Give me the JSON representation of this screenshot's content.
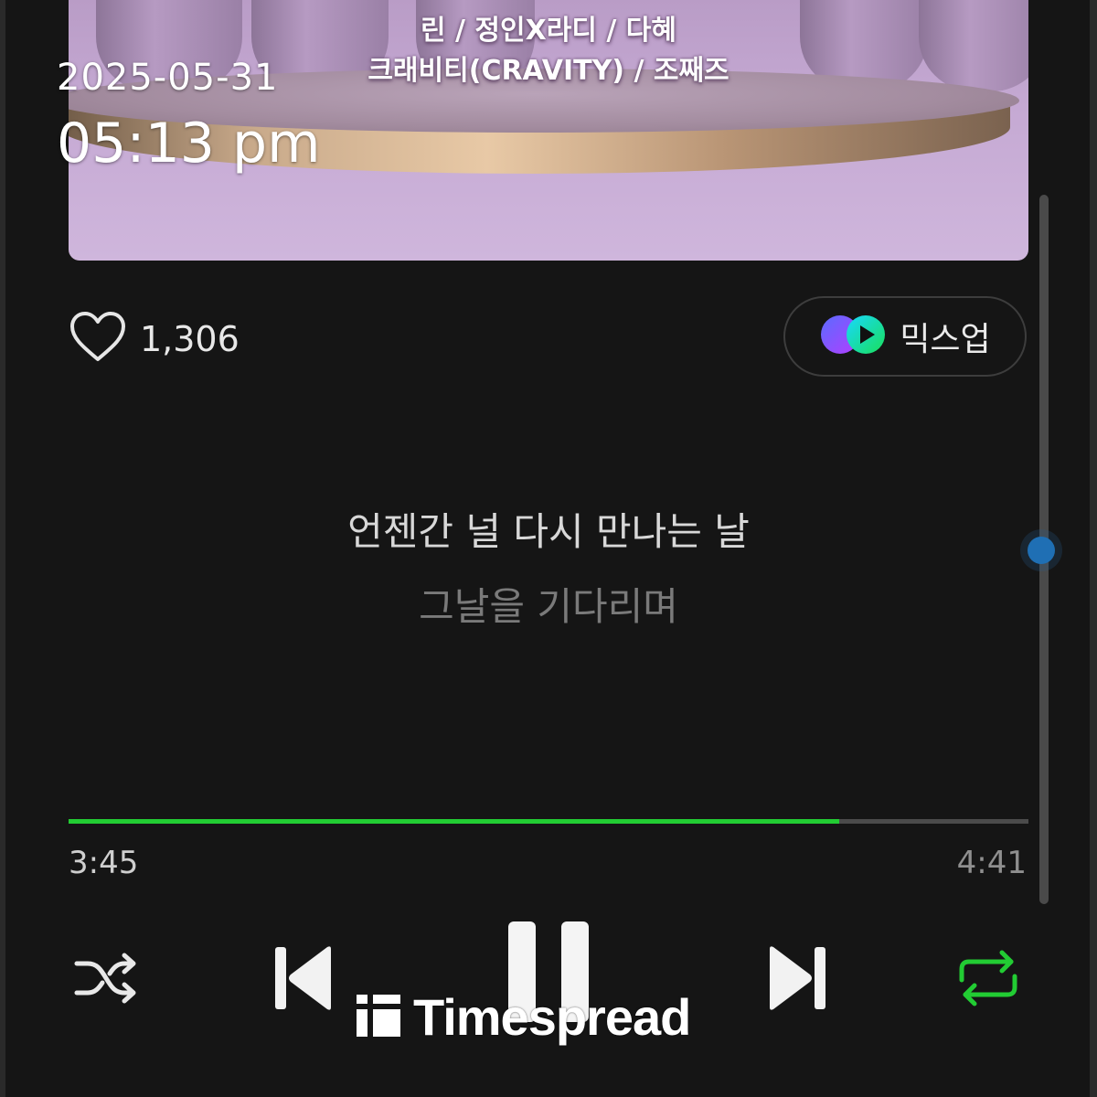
{
  "album": {
    "artists_line1": "린 / 정인X라디 / 다혜",
    "artists_line2": "크래비티(CRAVITY) / 조째즈"
  },
  "timestamp": {
    "date": "2025-05-31",
    "time": "05:13 pm"
  },
  "like": {
    "icon": "heart-outline-icon",
    "count": "1,306"
  },
  "mixup": {
    "icon": "mixup-logo-icon",
    "label": "믹스업"
  },
  "lyrics": {
    "current": "언젠간 널 다시 만나는 날",
    "next": "그날을 기다리며"
  },
  "progress": {
    "elapsed": "3:45",
    "total": "4:41",
    "fraction": 0.803,
    "color": "#22cc33"
  },
  "controls": {
    "shuffle_icon": "shuffle-icon",
    "prev_icon": "skip-previous-icon",
    "pause_icon": "pause-icon",
    "next_icon": "skip-next-icon",
    "repeat_icon": "repeat-icon",
    "repeat_active_color": "#22cc33"
  },
  "watermark": {
    "text": "Timespread"
  }
}
